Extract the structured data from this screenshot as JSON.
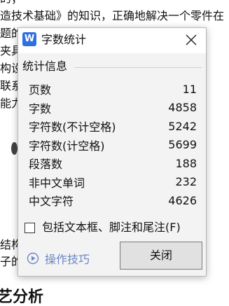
{
  "document": {
    "lines": [
      {
        "id": "l0",
        "text": "的；"
      },
      {
        "id": "l1",
        "text": "造技术基础》的知识，正确地解决一个零件在"
      },
      {
        "id": "l2",
        "text": "题的                                                  题的能"
      },
      {
        "id": "l3",
        "text": "夹具                                                  。通"
      },
      {
        "id": "l4",
        "text": "构设"
      },
      {
        "id": "l5",
        "text": "联系                                                  的相关"
      },
      {
        "id": "l6",
        "text": "能力"
      },
      {
        "id": "l7",
        "text": "结构                                                  ，承"
      },
      {
        "id": "l8",
        "text": "子的"
      }
    ],
    "heading": "艺分析"
  },
  "dialog": {
    "app_icon_letter": "W",
    "title": "字数统计",
    "group_label": "统计信息",
    "stats": [
      {
        "label": "页数",
        "value": "11"
      },
      {
        "label": "字数",
        "value": "4858"
      },
      {
        "label": "字符数(不计空格)",
        "value": "5242"
      },
      {
        "label": "字符数(计空格)",
        "value": "5699"
      },
      {
        "label": "段落数",
        "value": "188"
      },
      {
        "label": "非中文单词",
        "value": "232"
      },
      {
        "label": "中文字符",
        "value": "4626"
      }
    ],
    "checkbox_label": "包括文本框、脚注和尾注(F)",
    "checkbox_checked": false,
    "tips_label": "操作技巧",
    "close_button_label": "关闭"
  },
  "colors": {
    "app_icon_bg": "#2f6fe4",
    "tips_link": "#6b86c7"
  }
}
